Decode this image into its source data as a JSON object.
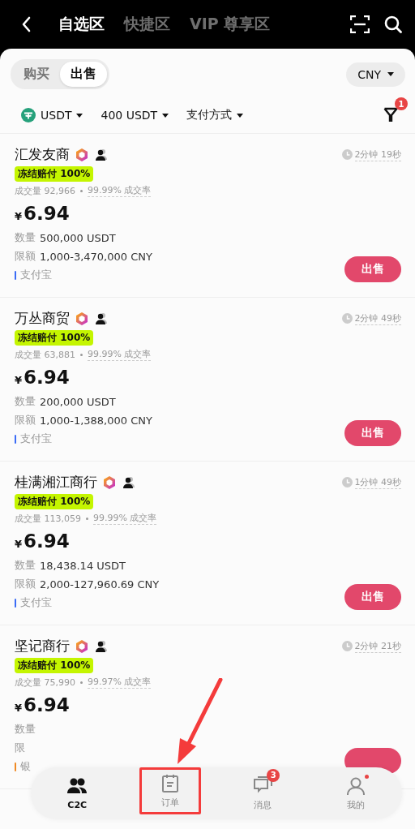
{
  "header": {
    "tabs": [
      {
        "label": "自选区",
        "selected": true
      },
      {
        "label": "快捷区",
        "selected": false
      },
      {
        "label": "VIP 尊享区",
        "selected": false
      }
    ]
  },
  "trade_toggle": [
    {
      "label": "购买",
      "selected": false
    },
    {
      "label": "出售",
      "selected": true
    }
  ],
  "currency": "CNY",
  "filters": [
    {
      "label": "USDT",
      "kind": "coin"
    },
    {
      "label": "400 USDT",
      "kind": "plain"
    },
    {
      "label": "支付方式",
      "kind": "plain"
    }
  ],
  "filter_badge": "1",
  "offers": [
    {
      "merchant": "汇发友商",
      "time": "2分钟 19秒",
      "tag": "冻结赔付 100%",
      "volume": "成交量 92,966",
      "rate": "99.99% 成交率",
      "currency_sign": "¥",
      "price": "6.94",
      "quantity_label": "数量",
      "quantity": "500,000 USDT",
      "limit_label": "限额",
      "limit": "1,000-3,470,000 CNY",
      "payment": "支付宝",
      "color": "#3b6cf6",
      "action": "出售"
    },
    {
      "merchant": "万丛商贸",
      "time": "2分钟 49秒",
      "tag": "冻结赔付 100%",
      "volume": "成交量 63,881",
      "rate": "99.99% 成交率",
      "currency_sign": "¥",
      "price": "6.94",
      "quantity_label": "数量",
      "quantity": "200,000 USDT",
      "limit_label": "限额",
      "limit": "1,000-1,388,000 CNY",
      "payment": "支付宝",
      "color": "#3b6cf6",
      "action": "出售"
    },
    {
      "merchant": "桂满湘江商行",
      "time": "1分钟 49秒",
      "tag": "冻结赔付 100%",
      "volume": "成交量 113,059",
      "rate": "99.99% 成交率",
      "currency_sign": "¥",
      "price": "6.94",
      "quantity_label": "数量",
      "quantity": "18,438.14 USDT",
      "limit_label": "限额",
      "limit": "2,000-127,960.69 CNY",
      "payment": "支付宝",
      "color": "#3b6cf6",
      "action": "出售"
    },
    {
      "merchant": "坚记商行",
      "time": "2分钟 21秒",
      "tag": "冻结赔付 100%",
      "volume": "成交量 75,990",
      "rate": "99.97% 成交率",
      "currency_sign": "¥",
      "price": "6.94",
      "quantity_label": "数量",
      "limit_label": "限",
      "payment": "银",
      "color": "#f08a24"
    }
  ],
  "bottom_nav": [
    {
      "label": "C2C",
      "kind": "people",
      "selected": true,
      "highlighted": false
    },
    {
      "label": "订单",
      "kind": "orders",
      "selected": false,
      "highlighted": true
    },
    {
      "label": "消息",
      "kind": "messages",
      "selected": false,
      "highlighted": false,
      "badge": "3"
    },
    {
      "label": "我的",
      "kind": "profile",
      "selected": false,
      "highlighted": false,
      "dot": true
    }
  ]
}
